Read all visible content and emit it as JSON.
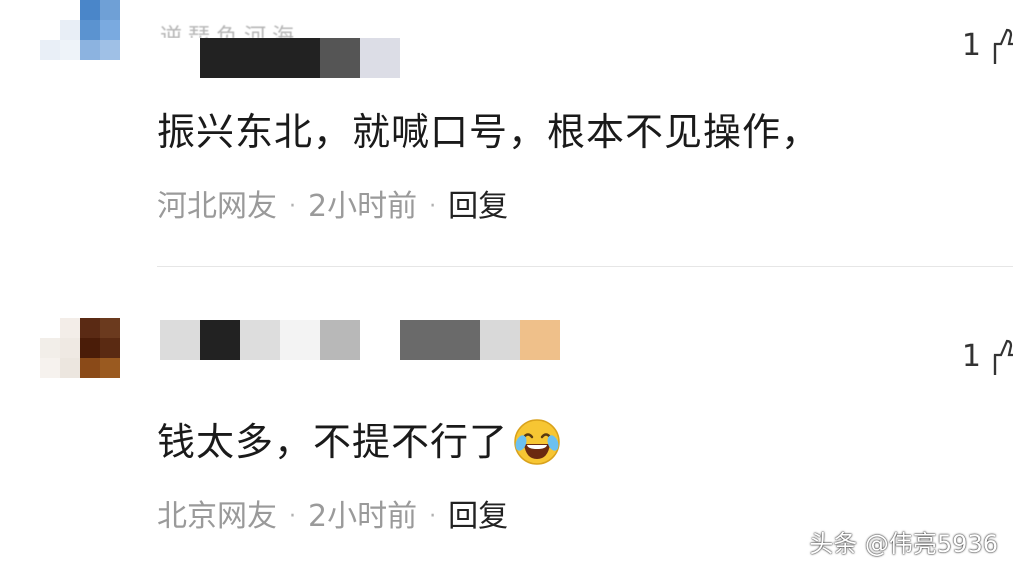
{
  "comments": [
    {
      "avatar_colors": [
        "#ffffff",
        "#ffffff",
        "#4a86c9",
        "#6fa0d6",
        "#ffffff",
        "#e8eef6",
        "#5b93d0",
        "#7aaae0",
        "#e9eff7",
        "#eef3f9",
        "#8cb3e0",
        "#9fc0e6",
        "#ffffff",
        "#ffffff",
        "#ffffff",
        "#ffffff"
      ],
      "name_partial": "逆琵负河海",
      "name_mosaic_colors": [
        "#ffffff",
        "#222222",
        "#222222",
        "#222222",
        "#555555",
        "#dcdde6",
        "#ffffff"
      ],
      "likes": "1",
      "text": "振兴东北，就喊口号，根本不见操作，",
      "region": "河北网友",
      "time": "2小时前",
      "reply_label": "回复"
    },
    {
      "avatar_colors": [
        "#ffffff",
        "#f3ede8",
        "#5a2a14",
        "#6b3a1e",
        "#f2eee9",
        "#efe9e3",
        "#4a1c08",
        "#5a2a12",
        "#f6f2ee",
        "#ece6df",
        "#8a4a18",
        "#9a5a20",
        "#ffffff",
        "#ffffff",
        "#ffffff",
        "#ffffff"
      ],
      "name_mosaic_colors": [
        "#dcdcdc",
        "#222222",
        "#dddddd",
        "#f3f3f3",
        "#b8b8b8",
        "#ffffff",
        "#6a6a6a",
        "#6a6a6a",
        "#d9d9d9",
        "#efc08a"
      ],
      "likes": "1",
      "text": "钱太多，不提不行了",
      "emoji": "laughing-tears",
      "region": "北京网友",
      "time": "2小时前",
      "reply_label": "回复"
    }
  ],
  "meta_separator": "·",
  "watermark": "头条 @伟亮5936",
  "colors": {
    "text": "#1a1a1a",
    "meta": "#9a9a9a",
    "divider": "#e6e6e6",
    "emoji_face": "#f7c633"
  }
}
